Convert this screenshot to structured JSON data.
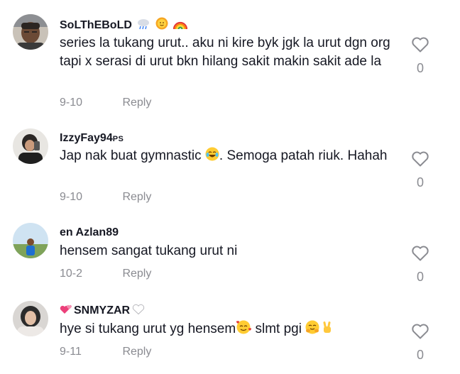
{
  "comments": [
    {
      "username": "SoLThEBoLD",
      "username_suffix_icons": [
        "cloud-rain-icon",
        "sun-face-icon",
        "rainbow-icon"
      ],
      "text": "series la tukang urut.. aku ni kire byk jgk la urut dgn org tapi x serasi di urut bkn hilang sakit makin sakit ade la",
      "date": "9-10",
      "reply_label": "Reply",
      "like_count": "0"
    },
    {
      "username": "IzzyFay94",
      "username_badge": "PS",
      "text_before_emoji": "Jap nak buat gymnastic ",
      "text_emoji": "laughing-tears-emoji",
      "text_after_emoji": ". Semoga patah riuk. Hahah",
      "date": "9-10",
      "reply_label": "Reply",
      "like_count": "0"
    },
    {
      "username": "en Azlan89",
      "text": "hensem sangat tukang urut ni",
      "date": "10-2",
      "reply_label": "Reply",
      "like_count": "0"
    },
    {
      "username": "SNMYZAR",
      "username_prefix_icon": "two-hearts-icon",
      "username_suffix_icon": "white-heart-icon",
      "text_part1": "hye si tukang urut yg hensem",
      "text_emoji1": "smiling-hearts-emoji",
      "text_part2": " slmt pgi ",
      "text_emoji2": "hugging-face-emoji",
      "text_emoji3": "victory-hand-emoji",
      "date": "9-11",
      "reply_label": "Reply",
      "like_count": "0"
    }
  ],
  "colors": {
    "text_primary": "#161823",
    "text_secondary": "#8a8b91",
    "background": "#ffffff"
  }
}
